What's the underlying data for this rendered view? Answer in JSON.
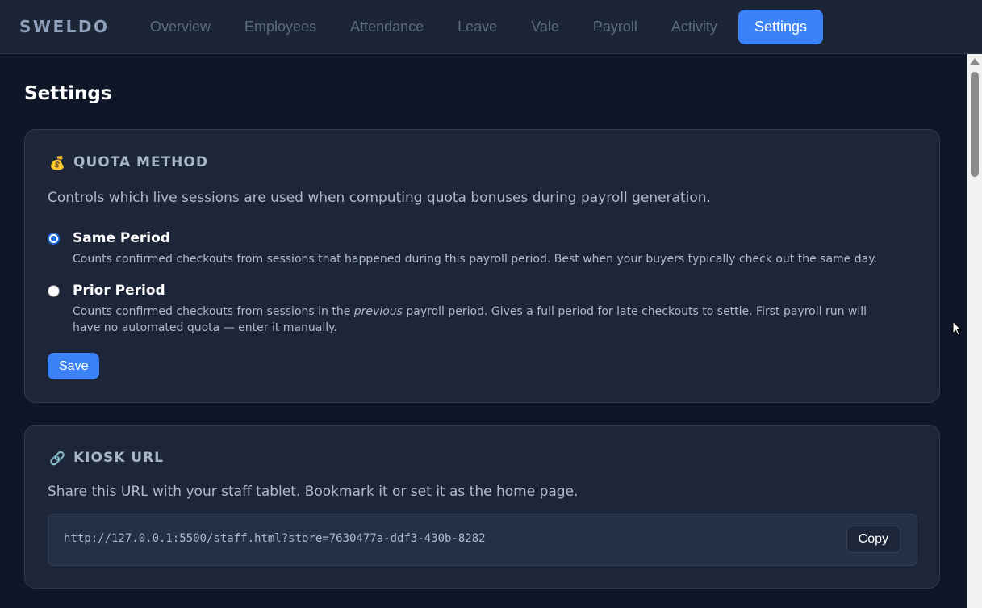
{
  "brand": "SWELDO",
  "nav": {
    "tabs": [
      {
        "label": "Overview"
      },
      {
        "label": "Employees"
      },
      {
        "label": "Attendance"
      },
      {
        "label": "Leave"
      },
      {
        "label": "Vale"
      },
      {
        "label": "Payroll"
      },
      {
        "label": "Activity"
      },
      {
        "label": "Settings"
      }
    ],
    "active": "Settings"
  },
  "page": {
    "title": "Settings"
  },
  "quota": {
    "icon": "money-bag-icon",
    "icon_glyph": "💰",
    "title": "QUOTA METHOD",
    "description": "Controls which live sessions are used when computing quota bonuses during payroll generation.",
    "options": [
      {
        "label": "Same Period",
        "help": "Counts confirmed checkouts from sessions that happened during this payroll period. Best when your buyers typically check out the same day.",
        "checked": true
      },
      {
        "label": "Prior Period",
        "help_before": "Counts confirmed checkouts from sessions in the ",
        "help_em": "previous",
        "help_after": " payroll period. Gives a full period for late checkouts to settle. First payroll run will have no automated quota — enter it manually.",
        "checked": false
      }
    ],
    "save_label": "Save"
  },
  "kiosk": {
    "icon": "link-icon",
    "icon_glyph": "🔗",
    "title": "KIOSK URL",
    "description": "Share this URL with your staff tablet. Bookmark it or set it as the home page.",
    "url": "http://127.0.0.1:5500/staff.html?store=7630477a-ddf3-430b-8282",
    "copy_label": "Copy"
  },
  "colors": {
    "accent": "#3b82f6",
    "background": "#0e1628",
    "card": "#1c2638"
  }
}
